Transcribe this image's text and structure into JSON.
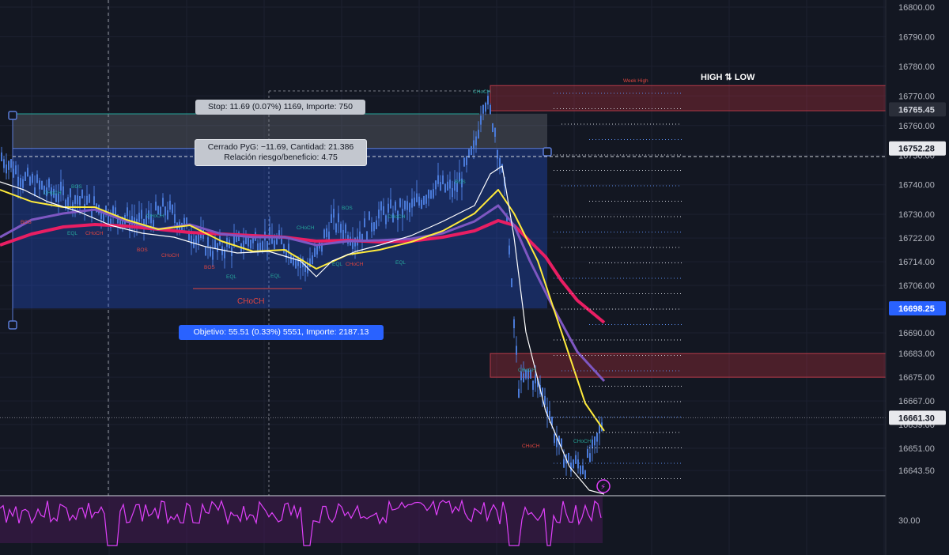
{
  "tooltips": {
    "stop": "Stop: 11.69 (0.07%) 1169, Importe: 750",
    "closed_line1": "Cerrado PyG: −11.69, Cantidad: 21.386",
    "closed_line2": "Relación riesgo/beneficio: 4.75",
    "target": "Objetivo: 55.51 (0.33%) 5551, Importe: 2187.13"
  },
  "labels": {
    "high_low": "HIGH ⇅ LOW",
    "week_high": "Week High",
    "choch": "CHoCH",
    "bos": "BOS",
    "eql": "EQL"
  },
  "colors": {
    "background": "#131722",
    "up_candle": "#4a7ad8",
    "ema_fast": "#ffffff",
    "ema_yellow": "#ffeb3b",
    "ema_purple": "#7e57c2",
    "ema_pink": "#e91e63",
    "target_zone": "#2962ff",
    "stop_zone": "#787b86",
    "supply_zone": "#f23645",
    "oscillator": "#e040fb"
  },
  "chart_data": {
    "type": "candlestick",
    "y_axis": {
      "range": [
        16640,
        16800
      ],
      "ticks": [
        "16800.00",
        "16790.00",
        "16780.00",
        "16770.00",
        "16760.00",
        "16750.00",
        "16740.00",
        "16730.00",
        "16722.00",
        "16714.00",
        "16706.00",
        "16698.00",
        "16690.00",
        "16683.00",
        "16675.00",
        "16667.00",
        "16659.00",
        "16651.00",
        "16643.50"
      ],
      "price_labels": [
        {
          "text": "16765.45",
          "value": 16765.45,
          "style": "dark"
        },
        {
          "text": "16752.28",
          "value": 16752.28,
          "style": "light"
        },
        {
          "text": "16698.25",
          "value": 16698.25,
          "style": "blue"
        },
        {
          "text": "16661.30",
          "value": 16661.3,
          "style": "light"
        }
      ]
    },
    "position": {
      "entry": 16752.28,
      "stop": 16764.0,
      "target": 16698.25
    },
    "supply_zones": [
      {
        "top": 16773.5,
        "bottom": 16765.0,
        "label": "Week High"
      },
      {
        "top": 16683.0,
        "bottom": 16675.0
      }
    ],
    "oscillator": {
      "level_label": "30.00",
      "level": 30
    }
  }
}
